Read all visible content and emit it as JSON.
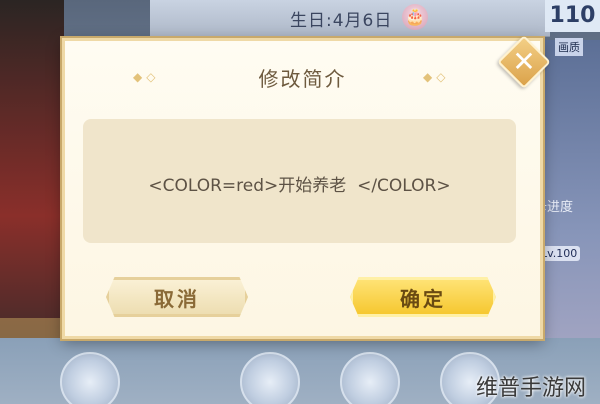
{
  "background": {
    "birthday_label": "生日:4月6日",
    "level_value": "110",
    "panel_label": "画质",
    "side_tag": "卡进度",
    "lv_badge": "Lv.100"
  },
  "dialog": {
    "title": "修改简介",
    "content": "<COLOR=red>开始养老  </COLOR>",
    "cancel_label": "取消",
    "confirm_label": "确定",
    "close_glyph": "✕",
    "ornament": "◆◇"
  },
  "watermark": "维普手游网",
  "colors": {
    "dialog_bg": "#fdf6e3",
    "confirm_button": "#f5c52a",
    "cancel_button": "#ecdcae",
    "title_text": "#6e5a3e"
  }
}
